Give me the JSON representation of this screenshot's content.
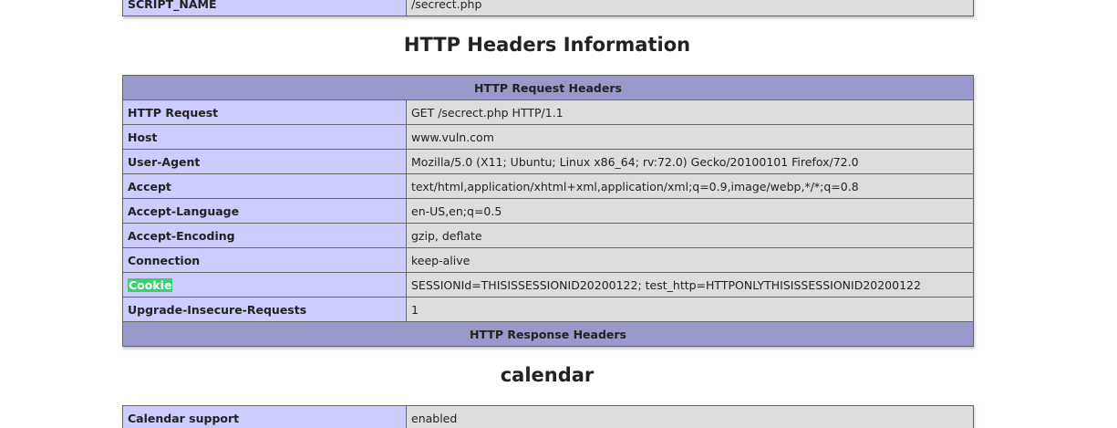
{
  "server_vars": {
    "rows": [
      {
        "key": "SCRIPT_NAME",
        "value": "/secrect.php"
      }
    ]
  },
  "headers_section": {
    "title": "HTTP Headers Information",
    "request_header": "HTTP Request Headers",
    "rows": [
      {
        "key": "HTTP Request",
        "value": "GET /secrect.php HTTP/1.1"
      },
      {
        "key": "Host",
        "value": "www.vuln.com"
      },
      {
        "key": "User-Agent",
        "value": "Mozilla/5.0 (X11; Ubuntu; Linux x86_64; rv:72.0) Gecko/20100101 Firefox/72.0"
      },
      {
        "key": "Accept",
        "value": "text/html,application/xhtml+xml,application/xml;q=0.9,image/webp,*/*;q=0.8"
      },
      {
        "key": "Accept-Language",
        "value": "en-US,en;q=0.5"
      },
      {
        "key": "Accept-Encoding",
        "value": "gzip, deflate"
      },
      {
        "key": "Connection",
        "value": "keep-alive"
      },
      {
        "key": "Cookie",
        "value": "SESSIONId=THISISSESSIONID20200122; test_http=HTTPONLYTHISISSESSIONID20200122"
      },
      {
        "key": "Upgrade-Insecure-Requests",
        "value": "1"
      }
    ],
    "response_header": "HTTP Response Headers"
  },
  "calendar_section": {
    "title": "calendar",
    "rows": [
      {
        "key": "Calendar support",
        "value": "enabled"
      }
    ]
  },
  "colors": {
    "key_cell": "#ccccff",
    "value_cell": "#dddddd",
    "header_cell": "#9999cc",
    "search_highlight": "#3ecf6e"
  }
}
